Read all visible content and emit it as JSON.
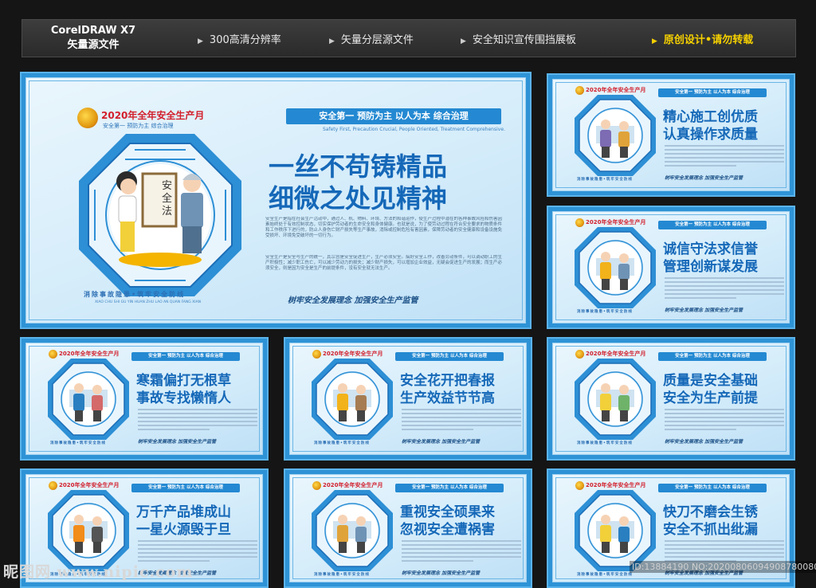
{
  "header": {
    "software": "CorelDRAW  X7",
    "subtitle": "矢量源文件",
    "features": [
      {
        "label": "300高清分辨率",
        "highlight": false
      },
      {
        "label": "矢量分层源文件",
        "highlight": false
      },
      {
        "label": "安全知识宣传围挡展板",
        "highlight": false
      },
      {
        "label": "原创设计•请勿转载",
        "highlight": true
      }
    ]
  },
  "colors": {
    "background": "#151515",
    "board_blue": "#2e93d6",
    "title_blue": "#1568b8",
    "year_red": "#d2202c",
    "highlight_yellow": "#f5d000"
  },
  "common": {
    "year_title": "2020年全年安全生产月",
    "year_sub": "安全第一  预防为主  综合治理",
    "slogan_bar": "安全第一 预防为主 以人为本 综合治理",
    "slogan_bar_en": "Safety First, Precaution Crucial, People Oriented, Treatment Comprehensive.",
    "footer_slogan": "树牢安全发展理念  加强安全生产监管",
    "bottom_line": "消除事故隐患•筑牢安全防线",
    "bottom_line_en": "XIAO CHU SHI GU YIN HUAN  ZHU LAO AN QUAN FANG XIAN"
  },
  "main_board": {
    "title_line1": "一丝不苟铸精品",
    "title_line2": "细微之处见精神",
    "sign_text": "安全法",
    "paragraph1": "安全生产是指在社会生产活动中，通过人、机、物料、环境、方法的和谐运作，使生产过程中潜在的各种事故风险和伤害因素始终处于有效控制状态，切实保护劳动者的生命安全和身体健康。也就是说，为了使劳动过程在符合安全要求的物质条件和工作秩序下进行的，防止人身伤亡财产损失等生产事故，消除或控制危险有害因素，保障劳动者的安全健康和设备设施免受损坏、环境免受破坏的一切行为。",
    "paragraph2": "安全生产是安全与生产的统一，其宗旨是安全促进生产，生产必须安全。搞好安全工作，改善劳动条件，可以调动职工的生产积极性；减少职工伤亡，可以减少劳动力的损失；减少财产损失，可以增加企业效益，无疑会促进生产的发展；而生产必须安全，则是因为安全是生产的前提条件，没有安全就无法生产。"
  },
  "boards": [
    {
      "title_line1": "精心施工创优质",
      "title_line2": "认真操作求质量"
    },
    {
      "title_line1": "诚信守法求信誉",
      "title_line2": "管理创新谋发展"
    },
    {
      "title_line1": "寒霜偏打无根草",
      "title_line2": "事故专找懒惰人"
    },
    {
      "title_line1": "安全花开把春报",
      "title_line2": "生产效益节节高"
    },
    {
      "title_line1": "质量是安全基础",
      "title_line2": "安全为生产前提"
    },
    {
      "title_line1": "万千产品堆成山",
      "title_line2": "一星火源毁于旦"
    },
    {
      "title_line1": "重视安全硕果来",
      "title_line2": "忽视安全遭祸害"
    },
    {
      "title_line1": "快刀不磨会生锈",
      "title_line2": "安全不抓出纰漏"
    }
  ],
  "watermark": {
    "site": "昵图网 www.nipic.com",
    "id": "ID:13884190 NO:20200806094908780080"
  }
}
